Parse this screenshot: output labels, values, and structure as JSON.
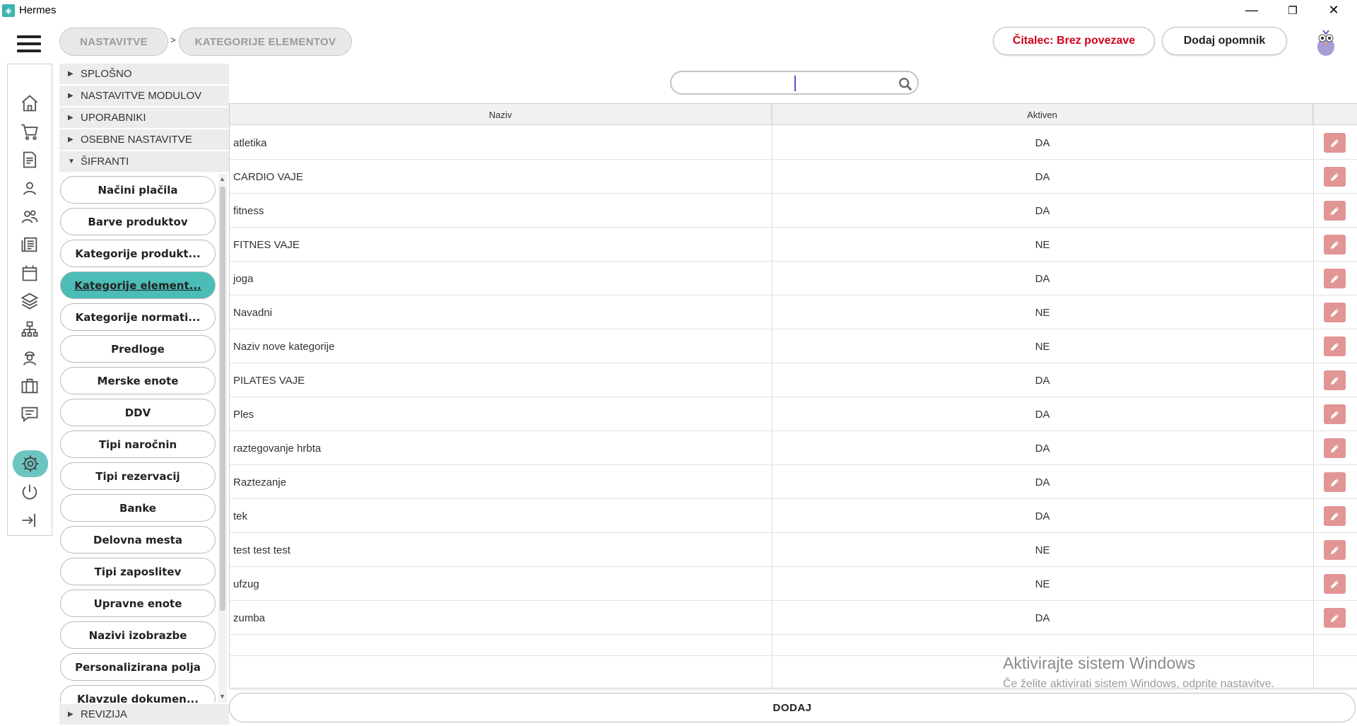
{
  "window": {
    "title": "Hermes",
    "icon": "hermes-app-icon",
    "controls": {
      "minimize": "—",
      "restore": "❐",
      "close": "✕"
    }
  },
  "breadcrumb": {
    "items": [
      "NASTAVITVE",
      "KATEGORIJE ELEMENTOV"
    ],
    "separator": ">"
  },
  "header": {
    "reader_status": "Čitalec: Brez povezave",
    "reminder_button": "Dodaj opomnik",
    "reader_status_color": "#d0021b"
  },
  "rail": {
    "icons": [
      "home-icon",
      "cart-icon",
      "document-icon",
      "person-icon",
      "people-icon",
      "newspaper-icon",
      "calendar-icon",
      "layers-icon",
      "network-icon",
      "worker-icon",
      "briefcase-icon",
      "chat-icon",
      "gear-icon",
      "power-icon",
      "logout-icon"
    ],
    "active_color": "#6cc5c1"
  },
  "nav": {
    "sections": [
      {
        "label": "SPLOŠNO",
        "expanded": false
      },
      {
        "label": "NASTAVITVE MODULOV",
        "expanded": false
      },
      {
        "label": "UPORABNIKI",
        "expanded": false
      },
      {
        "label": "OSEBNE NASTAVITVE",
        "expanded": false
      },
      {
        "label": "ŠIFRANTI",
        "expanded": true
      }
    ],
    "footer_section": {
      "label": "REVIZIJA",
      "expanded": false
    },
    "items": [
      "Načini plačila",
      "Barve produktov",
      "Kategorije produkt...",
      "Kategorije element...",
      "Kategorije normati...",
      "Predloge",
      "Merske enote",
      "DDV",
      "Tipi naročnin",
      "Tipi rezervacij",
      "Banke",
      "Delovna mesta",
      "Tipi zaposlitev",
      "Upravne enote",
      "Nazivi izobrazbe",
      "Personalizirana polja",
      "Klavzule dokumen..."
    ],
    "active_item": "Kategorije element...",
    "active_color": "#4cbcb6"
  },
  "search": {
    "value": "",
    "placeholder": ""
  },
  "table": {
    "columns": [
      "Naziv",
      "Aktiven"
    ],
    "rows": [
      {
        "name": "atletika",
        "active": "DA"
      },
      {
        "name": "CARDIO VAJE",
        "active": "DA"
      },
      {
        "name": "fitness",
        "active": "DA"
      },
      {
        "name": "FITNES VAJE",
        "active": "NE"
      },
      {
        "name": "joga",
        "active": "DA"
      },
      {
        "name": "Navadni",
        "active": "NE"
      },
      {
        "name": "Naziv nove kategorije",
        "active": "NE"
      },
      {
        "name": "PILATES VAJE",
        "active": "DA"
      },
      {
        "name": "Ples",
        "active": "DA"
      },
      {
        "name": "raztegovanje hrbta",
        "active": "DA"
      },
      {
        "name": "Raztezanje",
        "active": "DA"
      },
      {
        "name": "tek",
        "active": "DA"
      },
      {
        "name": "test test test",
        "active": "NE"
      },
      {
        "name": "ufzug",
        "active": "NE"
      },
      {
        "name": "zumba",
        "active": "DA"
      }
    ],
    "edit_icon": "pencil-icon",
    "edit_color": "#e29595"
  },
  "add_button": "DODAJ",
  "watermark": {
    "title": "Aktivirajte sistem Windows",
    "subtitle": "Če želite aktivirati sistem Windows, odprite nastavitve."
  }
}
